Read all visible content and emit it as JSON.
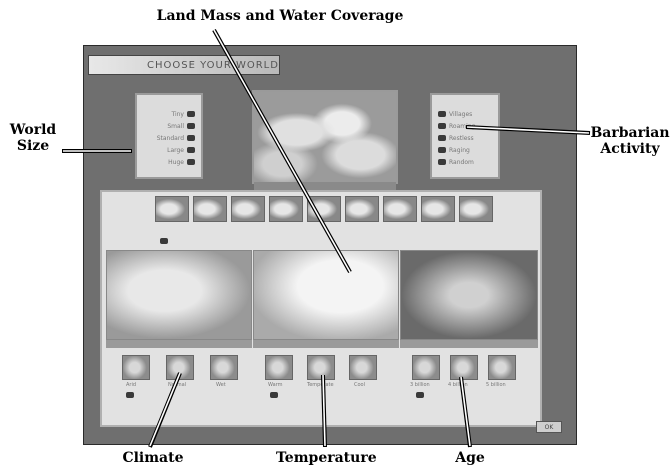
{
  "callouts": {
    "land_mass": "Land Mass and Water Coverage",
    "world_size_1": "World",
    "world_size_2": "Size",
    "barbarian_1": "Barbarian",
    "barbarian_2": "Activity",
    "climate": "Climate",
    "temperature": "Temperature",
    "age": "Age"
  },
  "window": {
    "title": "CHOOSE YOUR WORLD"
  },
  "world_size": {
    "options": [
      "Tiny",
      "Small",
      "Standard",
      "Large",
      "Huge"
    ]
  },
  "barbarian": {
    "options": [
      "Villages",
      "Roaming",
      "Restless",
      "Raging",
      "Random"
    ]
  },
  "climate": {
    "options": [
      "Arid",
      "Normal",
      "Wet"
    ]
  },
  "temperature": {
    "options": [
      "Warm",
      "Temperate",
      "Cool"
    ]
  },
  "age": {
    "options": [
      "3 billion",
      "4 billion",
      "5 billion"
    ]
  },
  "ok_label": "OK"
}
